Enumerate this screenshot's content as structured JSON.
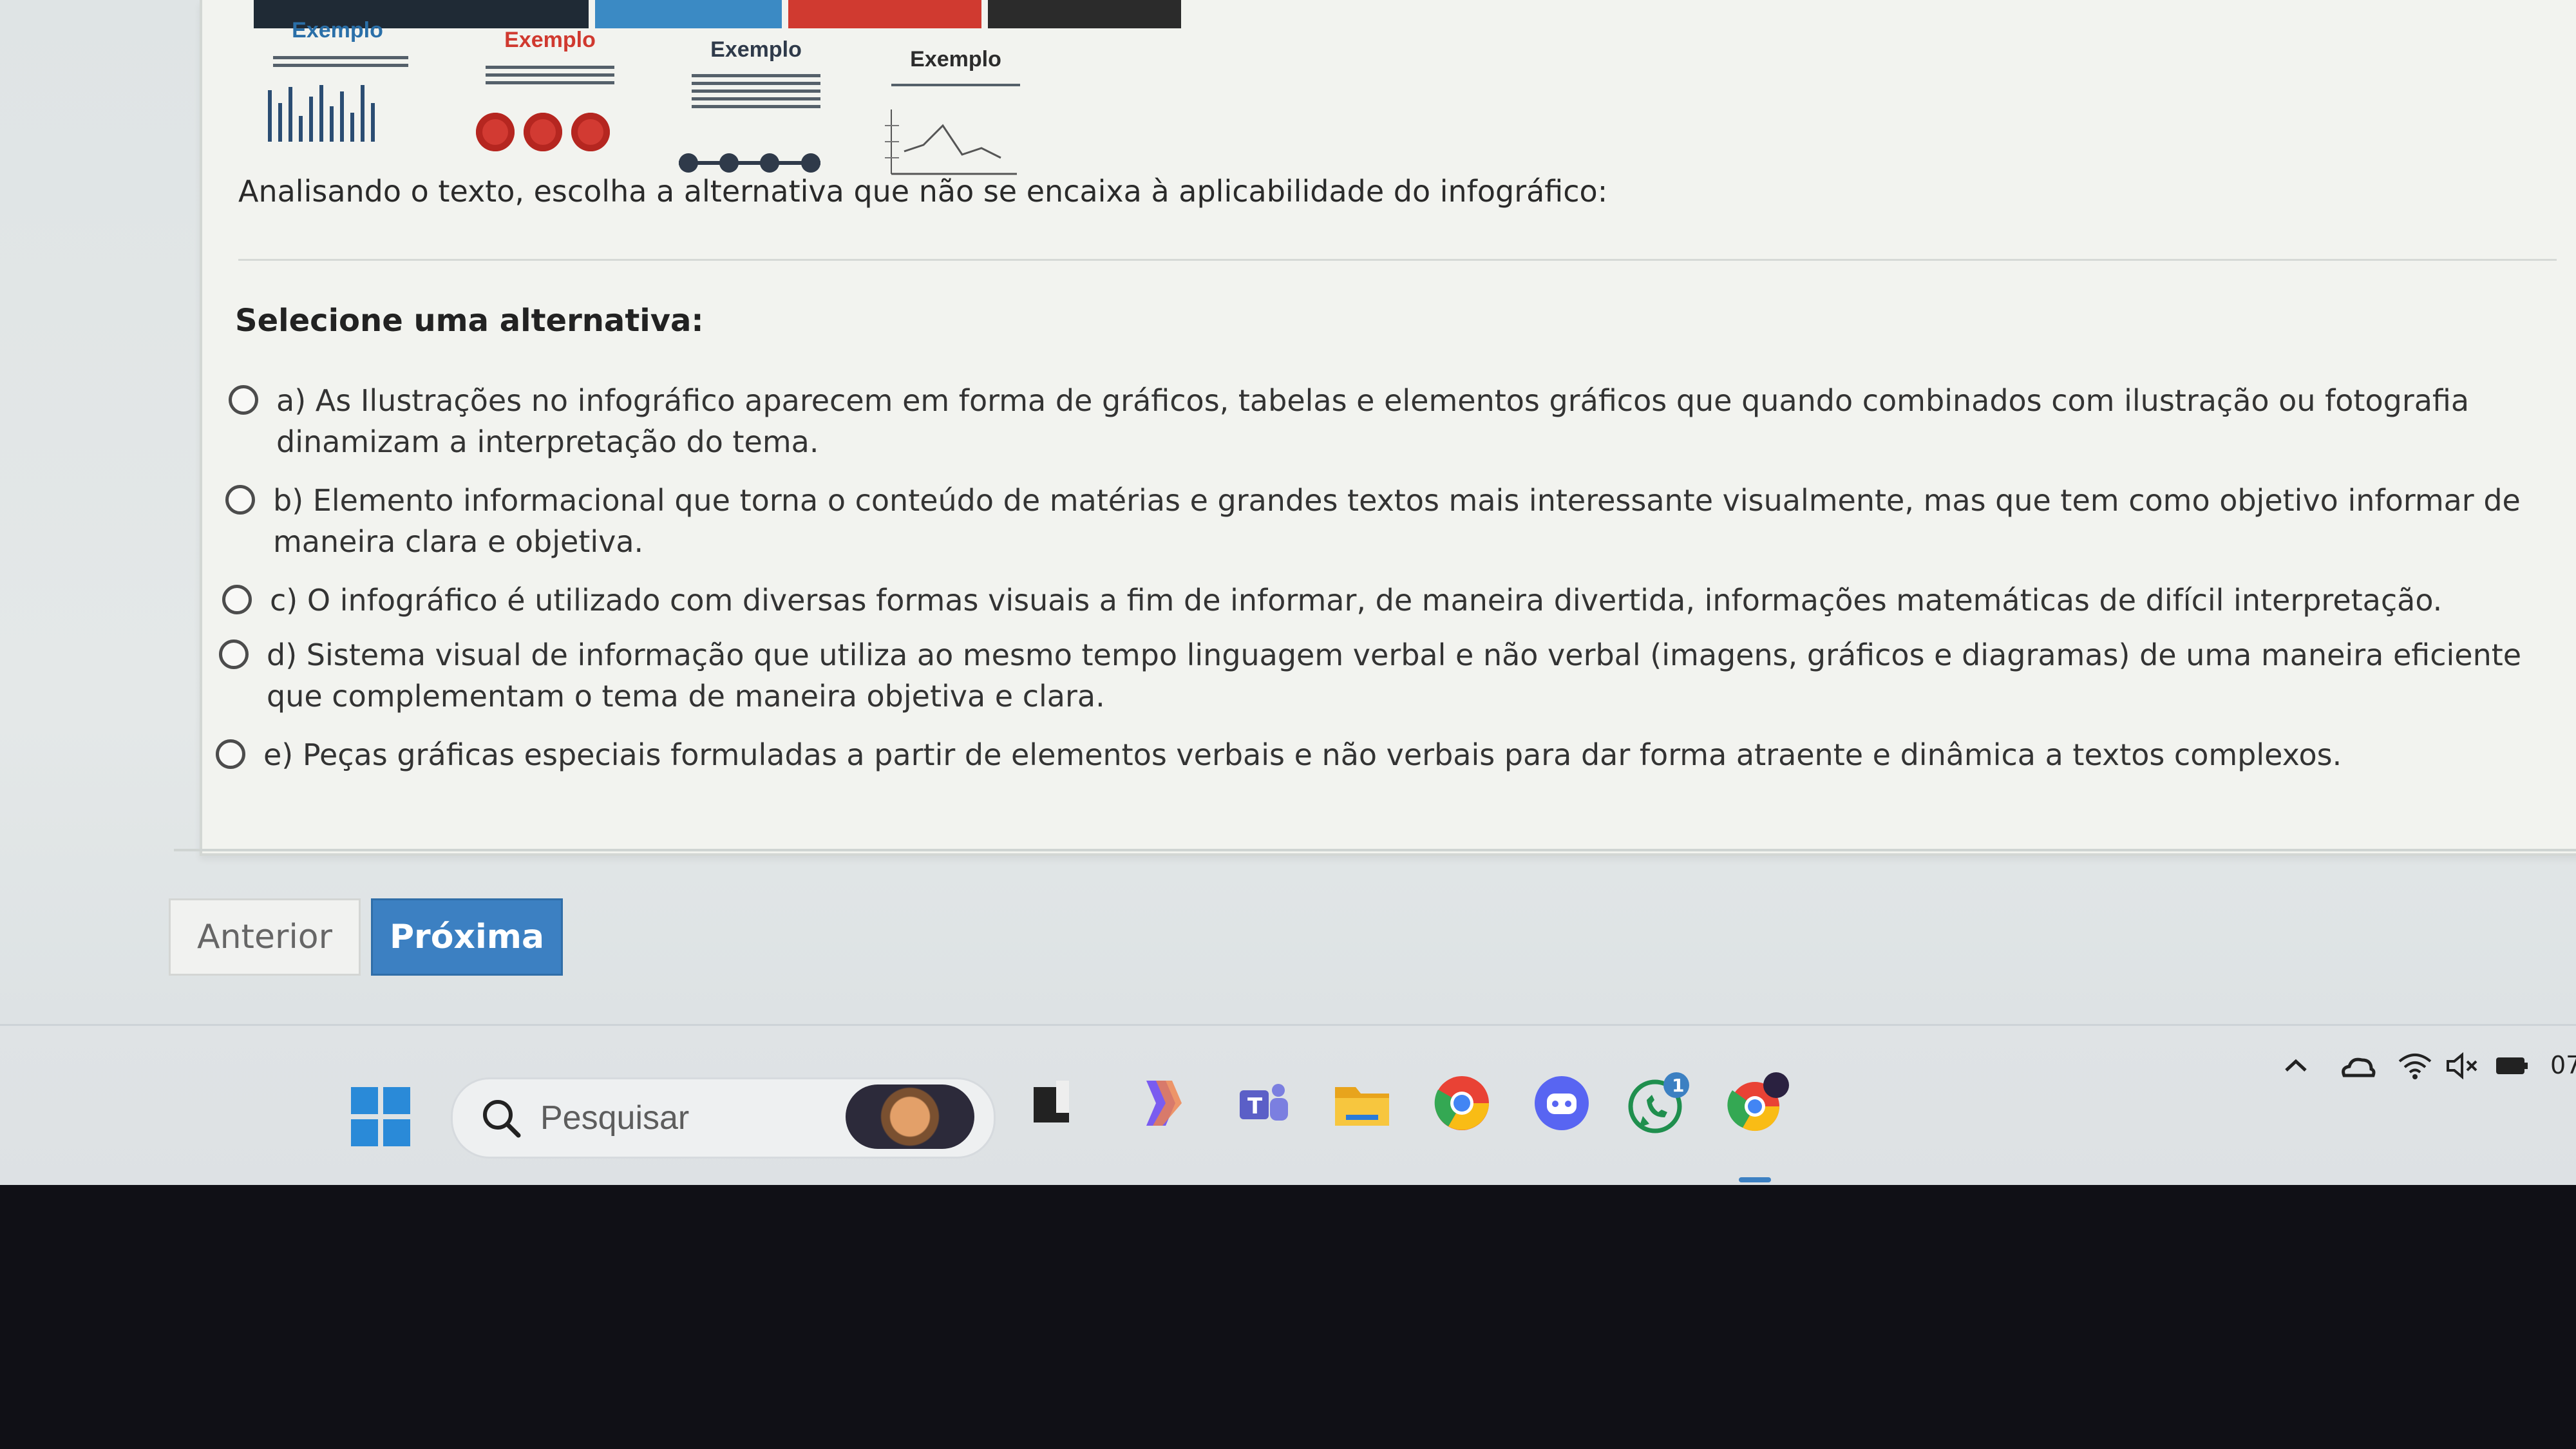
{
  "infographic": {
    "examples": [
      {
        "title": "Exemplo",
        "color": "#2a6fa8"
      },
      {
        "title": "Exemplo",
        "color": "#d0392f"
      },
      {
        "title": "Exemplo",
        "color": "#2f3a4a"
      },
      {
        "title": "Exemplo",
        "color": "#2c2c2c"
      }
    ],
    "top_bar_colors": [
      "#1f2a35",
      "#3b8ac4",
      "#d03a30",
      "#2b2b2b"
    ]
  },
  "question": {
    "text": "Analisando o texto, escolha a alternativa que não se encaixa à aplicabilidade do infográfico:",
    "select_label": "Selecione uma alternativa:",
    "options": [
      {
        "label": "a) As Ilustrações no infográfico aparecem em forma de gráficos, tabelas e elementos gráficos que quando combinados com ilustração ou fotografia dinamizam a interpretação do tema.",
        "selected": false
      },
      {
        "label": "b) Elemento informacional que torna o conteúdo de matérias e grandes textos mais interessante visualmente, mas que tem como objetivo informar de maneira clara e objetiva.",
        "selected": false
      },
      {
        "label": "c) O infográfico é utilizado com diversas formas visuais a fim de informar, de maneira divertida, informações matemáticas de difícil interpretação.",
        "selected": false
      },
      {
        "label": "d) Sistema visual de informação que utiliza ao mesmo tempo linguagem verbal e não verbal (imagens, gráficos e diagramas) de uma maneira eficiente que complementam o tema de maneira objetiva e clara.",
        "selected": false
      },
      {
        "label": "e) Peças gráficas especiais formuladas a partir de elementos verbais e não verbais para dar forma atraente e  dinâmica a textos complexos.",
        "selected": false
      }
    ]
  },
  "navigation": {
    "previous_label": "Anterior",
    "next_label": "Próxima",
    "accent_color": "#3c80c2"
  },
  "taskbar": {
    "search_placeholder": "Pesquisar",
    "apps": [
      "start-icon",
      "task-view-icon",
      "copilot-icon",
      "teams-icon",
      "file-explorer-icon",
      "chrome-icon",
      "discord-icon",
      "whatsapp-icon",
      "chrome-profile-icon"
    ],
    "whatsapp_badge": "1",
    "clock_partial": "07"
  }
}
